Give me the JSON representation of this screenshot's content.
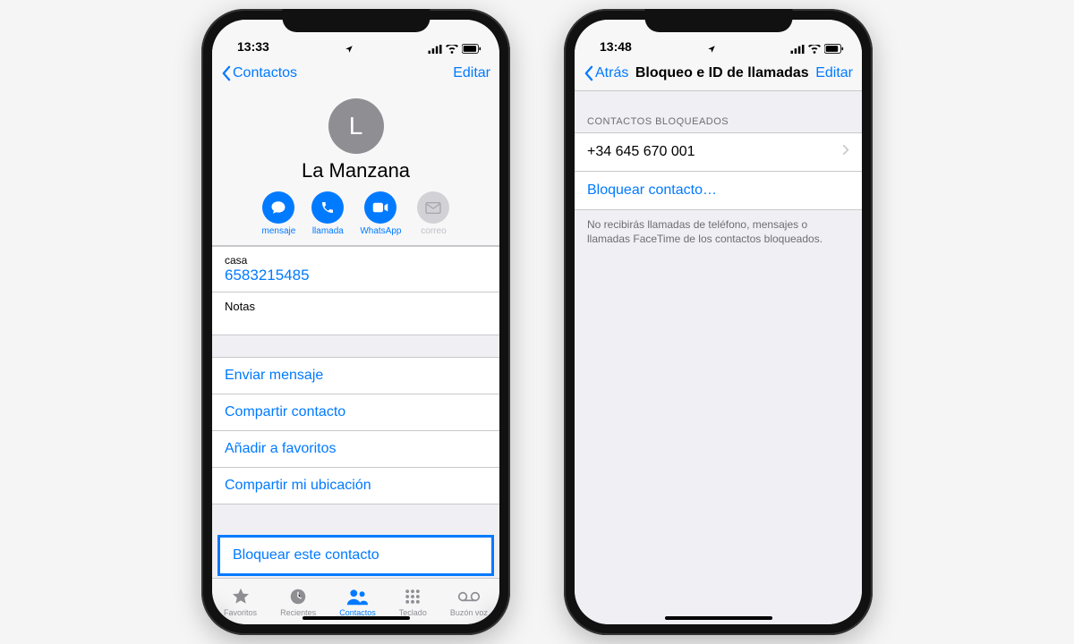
{
  "phone1": {
    "status_time": "13:33",
    "nav_back": "Contactos",
    "nav_edit": "Editar",
    "avatar_letter": "L",
    "contact_name": "La Manzana",
    "actions": {
      "message": "mensaje",
      "call": "llamada",
      "whatsapp": "WhatsApp",
      "mail": "correo"
    },
    "phone_label": "casa",
    "phone_number": "6583215485",
    "notes_label": "Notas",
    "menu": {
      "send_message": "Enviar mensaje",
      "share_contact": "Compartir contacto",
      "add_favorite": "Añadir a favoritos",
      "share_location": "Compartir mi ubicación",
      "block_contact": "Bloquear este contacto"
    },
    "tabs": {
      "favorites": "Favoritos",
      "recents": "Recientes",
      "contacts": "Contactos",
      "keypad": "Teclado",
      "voicemail": "Buzón voz"
    }
  },
  "phone2": {
    "status_time": "13:48",
    "nav_back": "Atrás",
    "nav_title": "Bloqueo e ID de llamadas",
    "nav_edit": "Editar",
    "section_header": "Contactos bloqueados",
    "blocked_number": "+34 645 670 001",
    "block_action": "Bloquear contacto…",
    "footer_note": "No recibirás llamadas de teléfono, mensajes o llamadas FaceTime de los contactos bloqueados."
  }
}
